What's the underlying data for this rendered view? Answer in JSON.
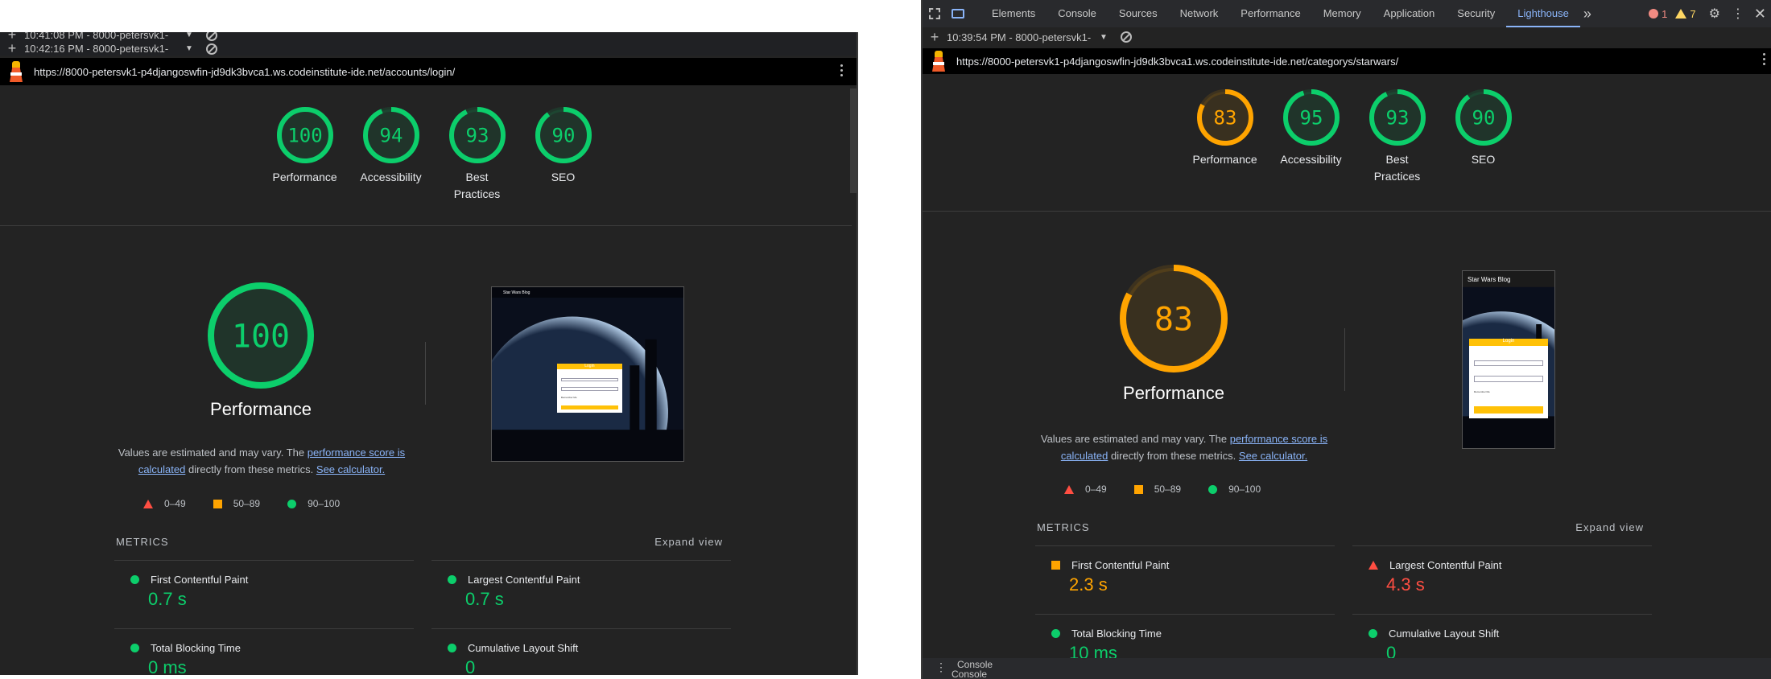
{
  "left": {
    "history": [
      {
        "time": "10:41:08 PM - 8000-petersvk1-"
      },
      {
        "time": "10:42:16 PM - 8000-petersvk1-"
      }
    ],
    "url": "https://8000-petersvk1-p4djangoswfin-jd9dk3bvca1.ws.codeinstitute-ide.net/accounts/login/",
    "scores": [
      {
        "value": "100",
        "label": "Performance",
        "level": 1.0,
        "color": "#0cce6b"
      },
      {
        "value": "94",
        "label": "Accessibility",
        "level": 0.94,
        "color": "#0cce6b"
      },
      {
        "value": "93",
        "label": "Best Practices",
        "level": 0.93,
        "color": "#0cce6b"
      },
      {
        "value": "90",
        "label": "SEO",
        "level": 0.9,
        "color": "#0cce6b"
      }
    ],
    "big": {
      "value": "100",
      "title": "Performance",
      "level": 1.0,
      "color": "#0cce6b"
    },
    "metrics": [
      {
        "label": "First Contentful Paint",
        "value": "0.7 s",
        "status": "good"
      },
      {
        "label": "Largest Contentful Paint",
        "value": "0.7 s",
        "status": "good"
      },
      {
        "label": "Total Blocking Time",
        "value": "0 ms",
        "status": "good"
      },
      {
        "label": "Cumulative Layout Shift",
        "value": "0",
        "status": "good"
      }
    ]
  },
  "right": {
    "tabs": [
      "Elements",
      "Console",
      "Sources",
      "Network",
      "Performance",
      "Memory",
      "Application",
      "Security",
      "Lighthouse"
    ],
    "active_tab": "Lighthouse",
    "errors": "1",
    "warnings": "7",
    "history": {
      "time": "10:39:54 PM - 8000-petersvk1-"
    },
    "url": "https://8000-petersvk1-p4djangoswfin-jd9dk3bvca1.ws.codeinstitute-ide.net/categorys/starwars/",
    "scores": [
      {
        "value": "83",
        "label": "Performance",
        "level": 0.83,
        "color": "#ffa400"
      },
      {
        "value": "95",
        "label": "Accessibility",
        "level": 0.95,
        "color": "#0cce6b"
      },
      {
        "value": "93",
        "label": "Best Practices",
        "level": 0.93,
        "color": "#0cce6b"
      },
      {
        "value": "90",
        "label": "SEO",
        "level": 0.9,
        "color": "#0cce6b"
      }
    ],
    "big": {
      "value": "83",
      "title": "Performance",
      "level": 0.83,
      "color": "#ffa400"
    },
    "metrics": [
      {
        "label": "First Contentful Paint",
        "value": "2.3 s",
        "status": "average"
      },
      {
        "label": "Largest Contentful Paint",
        "value": "4.3 s",
        "status": "fail"
      },
      {
        "label": "Total Blocking Time",
        "value": "10 ms",
        "status": "good"
      },
      {
        "label": "Cumulative Layout Shift",
        "value": "0",
        "status": "good"
      }
    ],
    "console_label": "Console",
    "console_label2": "Console"
  },
  "shared": {
    "desc_prefix": "Values are estimated and may vary. The ",
    "desc_link1": "performance score is calculated",
    "desc_mid": " directly from these metrics. ",
    "desc_link2": "See calculator.",
    "legend": [
      "0–49",
      "50–89",
      "90–100"
    ],
    "metrics_heading": "METRICS",
    "expand": "Expand view"
  },
  "thumb": {
    "site_title": "Star Wars Blog",
    "login": "Login",
    "remember": "Remember Me"
  },
  "colors": {
    "good": "#0cce6b",
    "average": "#ffa400",
    "fail": "#ff4e42",
    "accent": "#8ab4f8"
  }
}
